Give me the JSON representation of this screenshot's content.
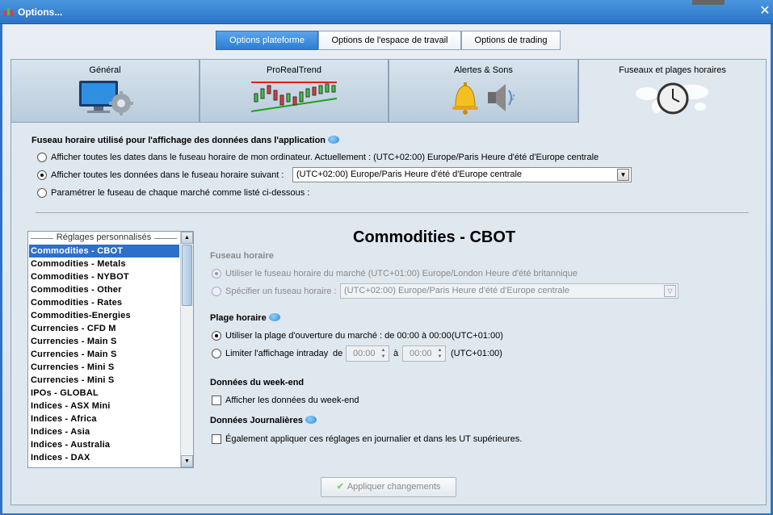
{
  "window": {
    "title": "Options..."
  },
  "top_segments": [
    {
      "label": "Options plateforme",
      "active": true
    },
    {
      "label": "Options de l'espace de travail",
      "active": false
    },
    {
      "label": "Options de trading",
      "active": false
    }
  ],
  "tabs": [
    {
      "label": "Général",
      "icon": "monitor-gear-icon"
    },
    {
      "label": "ProRealTrend",
      "icon": "trend-chart-icon"
    },
    {
      "label": "Alertes & Sons",
      "icon": "bell-speaker-icon"
    },
    {
      "label": "Fuseaux et plages horaires",
      "icon": "clock-world-icon",
      "active": true
    }
  ],
  "timezone_section": {
    "title": "Fuseau horaire utilisé pour l'affichage des données dans l'application",
    "option_computer": "Afficher toutes les dates dans le fuseau horaire de mon ordinateur. Actuellement : (UTC+02:00) Europe/Paris Heure d'été d'Europe centrale",
    "option_following": "Afficher toutes les données dans le fuseau horaire suivant :",
    "option_following_value": "(UTC+02:00) Europe/Paris Heure d'été d'Europe centrale",
    "option_per_market": "Paramétrer le fuseau de chaque marché comme listé ci-dessous :",
    "selected": "following"
  },
  "custom_list": {
    "header": "Réglages personnalisés",
    "items": [
      "Commodities - CBOT",
      "Commodities - Metals",
      "Commodities - NYBOT",
      "Commodities - Other",
      "Commodities - Rates",
      "Commodities-Energies",
      "Currencies - CFD M",
      "Currencies - Main S",
      "Currencies - Main S",
      "Currencies - Mini S",
      "Currencies - Mini S",
      "IPOs - GLOBAL",
      "Indices - ASX Mini",
      "Indices - Africa",
      "Indices - Asia",
      "Indices - Australia",
      "Indices - DAX"
    ],
    "selected_index": 0
  },
  "detail": {
    "heading": "Commodities - CBOT",
    "fuseau_title": "Fuseau horaire",
    "use_market_tz": "Utiliser le fuseau horaire du marché (UTC+01:00) Europe/London Heure d'été britannique",
    "specify_tz": "Spécifier un fuseau horaire :",
    "specify_tz_value": "(UTC+02:00) Europe/Paris Heure d'été d'Europe centrale",
    "plage_title": "Plage horaire",
    "use_market_hours": "Utiliser la plage d'ouverture du marché : de 00:00 à 00:00",
    "use_market_hours_tz": "(UTC+01:00)",
    "limit_intraday": "Limiter l'affichage intraday",
    "de_label": "de",
    "a_label": "à",
    "from_time": "00:00",
    "to_time": "00:00",
    "limit_tz": "(UTC+01:00)",
    "weekend_title": "Données du week-end",
    "weekend_checkbox": "Afficher les données du week-end",
    "daily_title": "Données Journalières",
    "daily_checkbox": "Également appliquer ces réglages en journalier et dans les UT supérieures."
  },
  "apply_button": "Appliquer changements",
  "colors": {
    "titlebar": "#2b73c8",
    "selection": "#2e6fc7",
    "active_segment": "#3a8be0"
  }
}
